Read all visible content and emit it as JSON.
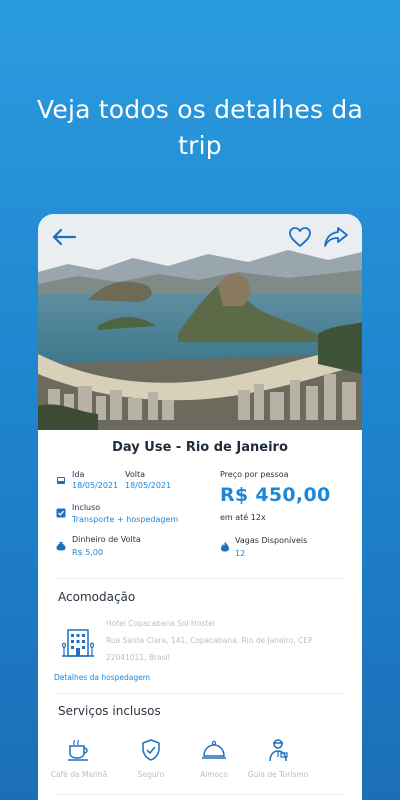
{
  "headline": {
    "line1": "Veja todos os detalhes da",
    "line2": "trip"
  },
  "trip": {
    "title": "Day Use - Rio de Janeiro",
    "ida_label": "Ida",
    "ida_date": "18/05/2021",
    "volta_label": "Volta",
    "volta_date": "18/05/2021",
    "incluso_label": "Incluso",
    "incluso_value": "Transporte + hospedagem",
    "dinheiro_label": "Dinheiro de Volta",
    "dinheiro_value": "R$ 5,00",
    "preco_label": "Preço por pessoa",
    "preco_value": "R$ 450,00",
    "parcelas": "em até 12x",
    "vagas_label": "Vagas Disponíveis",
    "vagas_value": "12"
  },
  "acomodacao": {
    "title": "Acomodação",
    "hotel_name": "Hotel Copacabana Sol Hostel",
    "address_line1": "Rua Santa Clara, 141, Copacabana, Rio de Janeiro, CEP",
    "address_line2": "22041011, Brasil",
    "details_link": "Detalhes da hospedagem"
  },
  "servicos": {
    "title": "Serviços inclusos",
    "items": [
      {
        "label": "Café da Manhã",
        "icon": "coffee-cup-icon"
      },
      {
        "label": "Seguro",
        "icon": "shield-check-icon"
      },
      {
        "label": "Almoço",
        "icon": "food-cloche-icon"
      },
      {
        "label": "Guia de Turismo",
        "icon": "tour-guide-icon"
      }
    ]
  },
  "colors": {
    "accent": "#1e88d8",
    "background_top": "#2b9be0",
    "background_bottom": "#1b6fb8"
  }
}
